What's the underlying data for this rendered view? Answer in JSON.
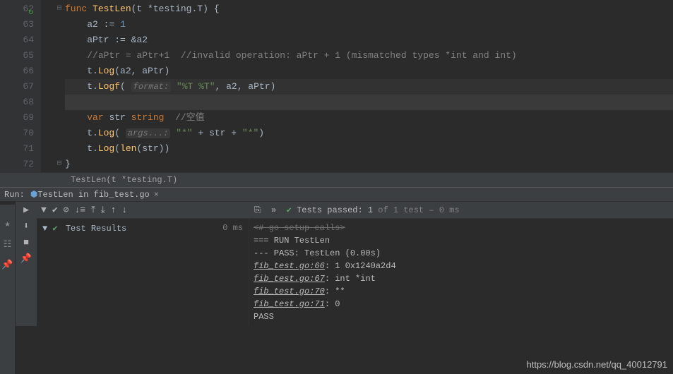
{
  "gutter": {
    "start": 62,
    "end": 72
  },
  "code": {
    "l62": {
      "func": "func",
      "name": "TestLen",
      "sig1": "(t *",
      "sigT": "testing",
      "sig2": ".",
      "sigTT": "T",
      "sig3": ") {"
    },
    "l63": {
      "a": "a2",
      "op": ":=",
      "v": "1"
    },
    "l64": {
      "a": "aPtr",
      "op": ":=",
      "amp": "&",
      "b": "a2"
    },
    "l65": {
      "cmt": "//aPtr = aPtr+1  //invalid operation: aPtr + 1 (mismatched types *int and int)"
    },
    "l66": {
      "t": "t.",
      "fn": "Log",
      "args": "(a2, aPtr)"
    },
    "l67": {
      "t": "t.",
      "fn": "Logf",
      "open": "( ",
      "hint": "format:",
      "str": "\"%T %T\"",
      "rest": ", a2, aPtr)"
    },
    "l69": {
      "var": "var",
      "id": "str",
      "typ": "string",
      "cmt": "//空值"
    },
    "l70": {
      "t": "t.",
      "fn": "Log",
      "open": "( ",
      "hint": "args...:",
      "s1": "\"*\"",
      "plus1": " + str + ",
      "s2": "\"*\"",
      "close": ")"
    },
    "l71": {
      "t": "t.",
      "fn": "Log",
      "open": "(",
      "len": "len",
      "arg": "(str))"
    },
    "l72": {
      "brace": "}"
    }
  },
  "crumbs": "TestLen(t *testing.T)",
  "run": {
    "label": "Run:",
    "tab": "TestLen in fib_test.go",
    "passbar_prefix": "Tests passed: 1",
    "passbar_suffix": " of 1 test – 0 ms",
    "results": "Test Results",
    "results_time": "0 ms"
  },
  "output": {
    "setup": "<# go setup calls>",
    "run": "=== RUN   TestLen",
    "pass": "--- PASS: TestLen (0.00s)",
    "l1f": "fib_test.go:66",
    "l1v": ": 1 0x1240a2d4",
    "l2f": "fib_test.go:67",
    "l2v": ": int *int",
    "l3f": "fib_test.go:70",
    "l3v": ": **",
    "l4f": "fib_test.go:71",
    "l4v": ": 0",
    "final": "PASS"
  },
  "watermark": "https://blog.csdn.net/qq_40012791"
}
